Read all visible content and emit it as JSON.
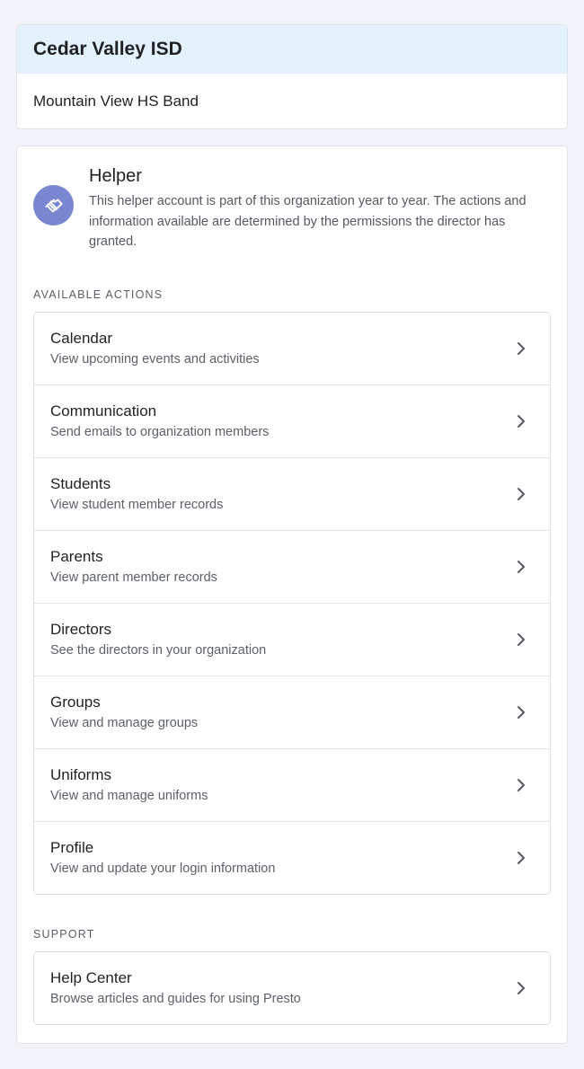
{
  "organization": {
    "name": "Cedar Valley ISD",
    "program": "Mountain View HS Band"
  },
  "helper": {
    "title": "Helper",
    "description": "This helper account is part of this organization year to year. The actions and information available are determined by the permissions the director has granted.",
    "icon": "handshake-icon",
    "accent_color": "#7a86cf"
  },
  "actions_section": {
    "label": "AVAILABLE ACTIONS",
    "items": [
      {
        "title": "Calendar",
        "subtitle": "View upcoming events and activities"
      },
      {
        "title": "Communication",
        "subtitle": "Send emails to organization members"
      },
      {
        "title": "Students",
        "subtitle": "View student member records"
      },
      {
        "title": "Parents",
        "subtitle": "View parent member records"
      },
      {
        "title": "Directors",
        "subtitle": "See the directors in your organization"
      },
      {
        "title": "Groups",
        "subtitle": "View and manage groups"
      },
      {
        "title": "Uniforms",
        "subtitle": "View and manage uniforms"
      },
      {
        "title": "Profile",
        "subtitle": "View and update your login information"
      }
    ]
  },
  "support_section": {
    "label": "SUPPORT",
    "items": [
      {
        "title": "Help Center",
        "subtitle": "Browse articles and guides for using Presto"
      }
    ]
  }
}
